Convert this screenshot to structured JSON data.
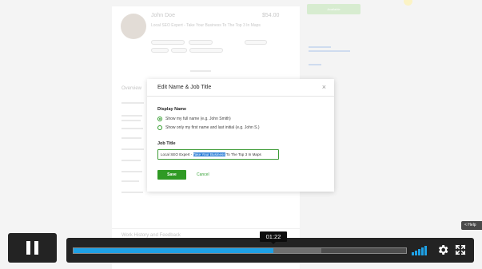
{
  "background": {
    "profile_name": "John Doe",
    "profile_rate": "$54.00",
    "profile_title": "Local SEO Expert - Take Your Business To The Top 3 In Maps",
    "availability_button": "Available",
    "overview_heading": "Overview",
    "work_heading": "Work History and Feedback"
  },
  "modal": {
    "title": "Edit Name & Job Title",
    "close_icon": "close-icon",
    "display_name_label": "Display Name",
    "option_full_name": "Show my full name (e.g. John Smith)",
    "option_initial": "Show only my first name and last initial (e.g. John S.)",
    "selected_option": "full_name",
    "job_title_label": "Job Title",
    "job_title_before": "Local SEO Expert - ",
    "job_title_selected": "Take Your Business",
    "job_title_after": " To The Top 3 In Maps",
    "save_label": "Save",
    "cancel_label": "Cancel"
  },
  "help_tab": {
    "label": "< Help"
  },
  "player": {
    "timecode": "01:22",
    "progress_fraction": 0.6,
    "buffered_fraction": 0.745,
    "icons": [
      "pause-icon",
      "volume-icon",
      "gear-icon",
      "fullscreen-icon"
    ],
    "accent_color": "#1ea1e6"
  }
}
